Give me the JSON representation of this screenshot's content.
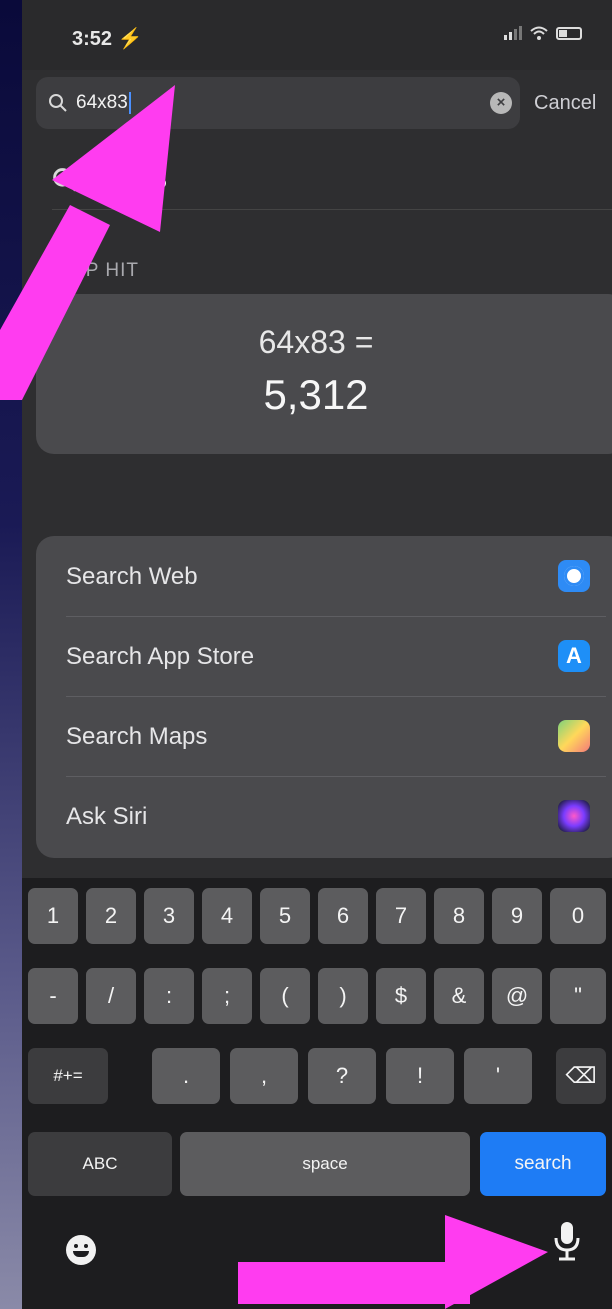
{
  "status": {
    "time": "3:52 ⚡"
  },
  "search": {
    "query": "64x83",
    "cancel_label": "Cancel"
  },
  "suggestion": {
    "text": "83"
  },
  "top_hit": {
    "label": "OP HIT",
    "expression": "64x83 =",
    "result": "5,312"
  },
  "actions": [
    {
      "label": "Search Web",
      "icon": "safari-icon"
    },
    {
      "label": "Search App Store",
      "icon": "app-store-icon"
    },
    {
      "label": "Search Maps",
      "icon": "maps-icon"
    },
    {
      "label": "Ask Siri",
      "icon": "siri-icon"
    }
  ],
  "keyboard": {
    "row1": [
      "1",
      "2",
      "3",
      "4",
      "5",
      "6",
      "7",
      "8",
      "9",
      "0"
    ],
    "row2": [
      "-",
      "/",
      ":",
      ";",
      "(",
      ")",
      "$",
      "&",
      "@",
      "\""
    ],
    "row3": [
      "#+=",
      ".",
      ",",
      "?",
      "!",
      "'"
    ],
    "abc_label": "ABC",
    "space_label": "space",
    "search_label": "search",
    "delete_symbol": "⌫"
  },
  "colors": {
    "annotation_arrow": "#ff3cf0",
    "search_key": "#1e7cf5"
  }
}
